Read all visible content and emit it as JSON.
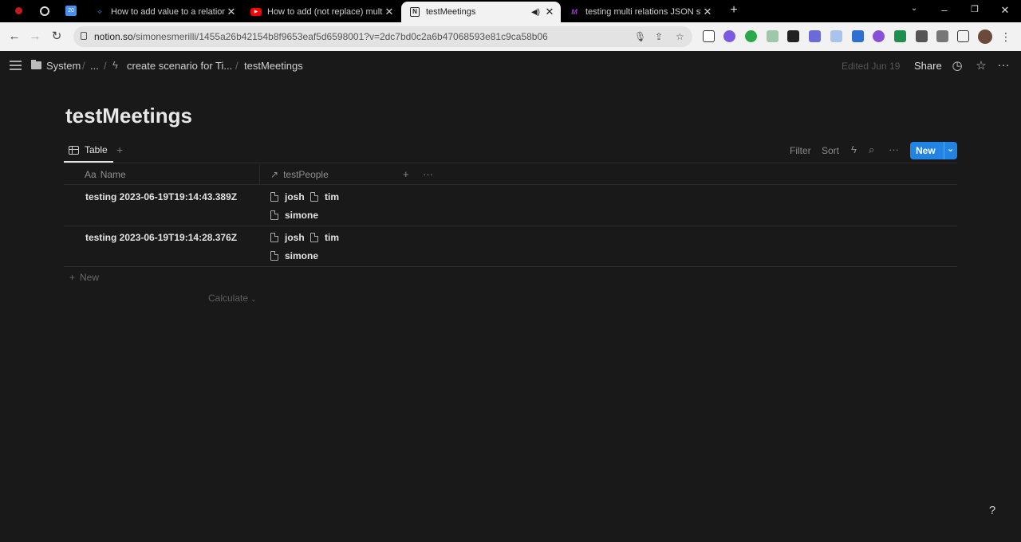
{
  "browser": {
    "tabs": [
      {
        "title": "How to add value to a relation p",
        "favicon": "spark-icon",
        "color": "#4a8ef0"
      },
      {
        "title": "How to add (not replace) multipl",
        "favicon": "youtube-icon",
        "color": "#ff0000"
      },
      {
        "title": "testMeetings",
        "favicon": "notion-icon",
        "color": "#000000",
        "active": true
      },
      {
        "title": "testing multi relations JSON stru",
        "favicon": "make-icon",
        "color": "#a23bd6"
      }
    ],
    "url_host": "notion.so",
    "url_path": "/simonesmerilli/1455a26b42154b8f9653eaf5d6598001?v=2dc7bd0c2a6b47068593e81c9ca58b06"
  },
  "notion": {
    "breadcrumbs": [
      "System",
      "...",
      "create scenario for Ti...",
      "testMeetings"
    ],
    "edited": "Edited Jun 19",
    "share": "Share",
    "page_title": "testMeetings",
    "view_tab": "Table",
    "actions": {
      "filter": "Filter",
      "sort": "Sort",
      "new": "New"
    },
    "columns": {
      "name_prefix": "Aa",
      "name": "Name",
      "relation": "testPeople"
    },
    "rows": [
      {
        "name": "testing 2023-06-19T19:14:43.389Z",
        "people": [
          "josh",
          "tim",
          "simone"
        ]
      },
      {
        "name": "testing 2023-06-19T19:14:28.376Z",
        "people": [
          "josh",
          "tim",
          "simone"
        ]
      }
    ],
    "new_row": "New",
    "calculate": "Calculate",
    "help": "?"
  },
  "colors": {
    "accent": "#2383e2",
    "background": "#191919"
  }
}
